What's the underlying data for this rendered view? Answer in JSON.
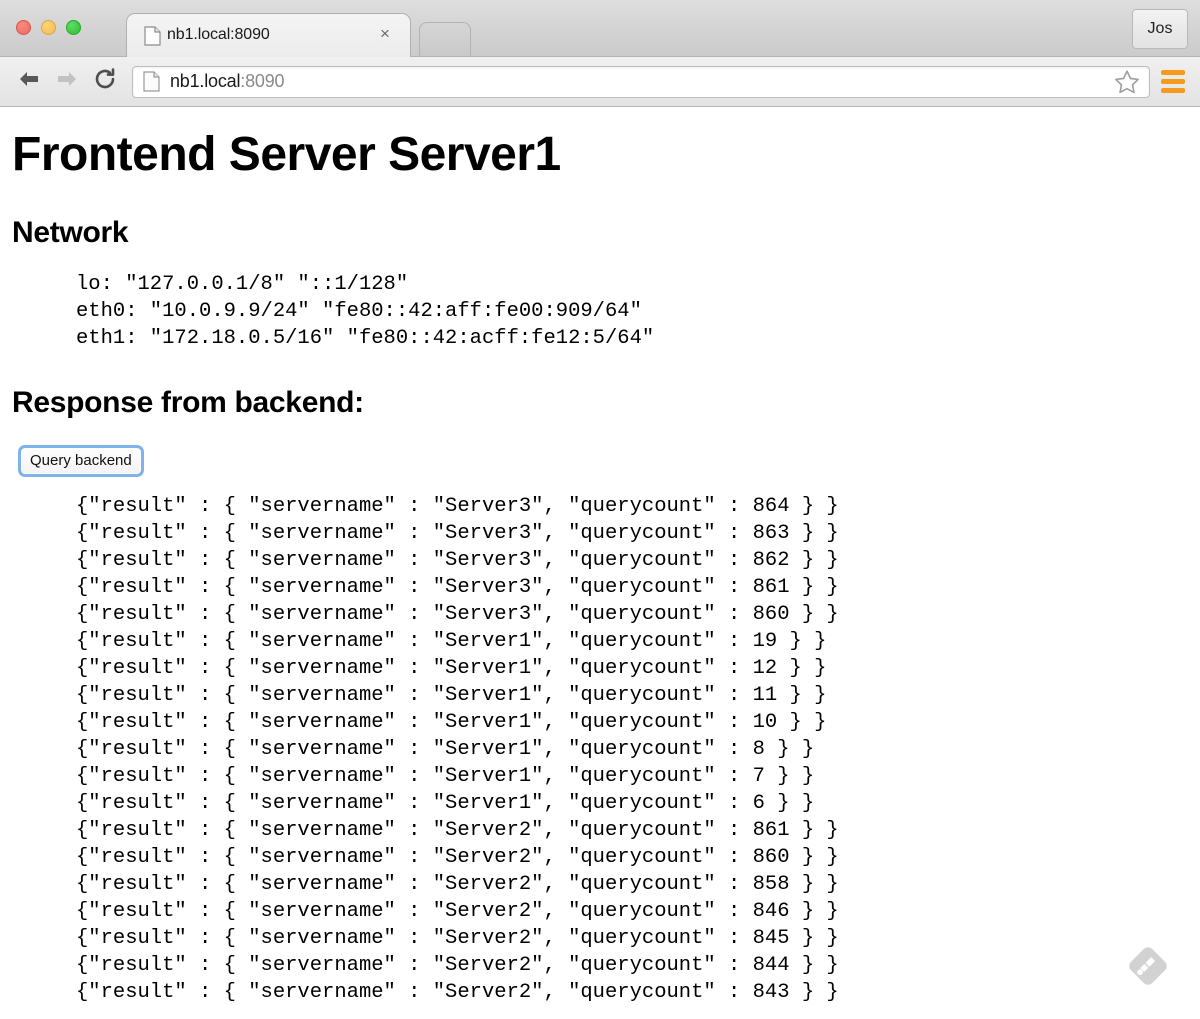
{
  "browser": {
    "window_controls": [
      "close",
      "minimize",
      "zoom"
    ],
    "tab": {
      "title": "nb1.local:8090",
      "close_label": "×",
      "favicon": "document-icon"
    },
    "new_tab_label": "",
    "profile_label": "Jos",
    "toolbar": {
      "back_label": "Back",
      "forward_label": "Forward",
      "reload_label": "Reload",
      "url_host": "nb1.local",
      "url_port": ":8090",
      "bookmark_label": "Bookmark this page",
      "menu_label": "Customize and control",
      "menu_color": "#f59b1c"
    }
  },
  "page": {
    "title": "Frontend Server Server1",
    "network_heading": "Network",
    "network_lines": [
      "lo: \"127.0.0.1/8\" \"::1/128\"",
      "eth0: \"10.0.9.9/24\" \"fe80::42:aff:fe00:909/64\"",
      "eth1: \"172.18.0.5/16\" \"fe80::42:acff:fe12:5/64\""
    ],
    "response_heading": "Response from backend:",
    "query_button_label": "Query backend",
    "results": [
      "{\"result\" : { \"servername\" : \"Server3\", \"querycount\" : 864 } }",
      "{\"result\" : { \"servername\" : \"Server3\", \"querycount\" : 863 } }",
      "{\"result\" : { \"servername\" : \"Server3\", \"querycount\" : 862 } }",
      "{\"result\" : { \"servername\" : \"Server3\", \"querycount\" : 861 } }",
      "{\"result\" : { \"servername\" : \"Server3\", \"querycount\" : 860 } }",
      "{\"result\" : { \"servername\" : \"Server1\", \"querycount\" : 19 } }",
      "{\"result\" : { \"servername\" : \"Server1\", \"querycount\" : 12 } }",
      "{\"result\" : { \"servername\" : \"Server1\", \"querycount\" : 11 } }",
      "{\"result\" : { \"servername\" : \"Server1\", \"querycount\" : 10 } }",
      "{\"result\" : { \"servername\" : \"Server1\", \"querycount\" : 8 } }",
      "{\"result\" : { \"servername\" : \"Server1\", \"querycount\" : 7 } }",
      "{\"result\" : { \"servername\" : \"Server1\", \"querycount\" : 6 } }",
      "{\"result\" : { \"servername\" : \"Server2\", \"querycount\" : 861 } }",
      "{\"result\" : { \"servername\" : \"Server2\", \"querycount\" : 860 } }",
      "{\"result\" : { \"servername\" : \"Server2\", \"querycount\" : 858 } }",
      "{\"result\" : { \"servername\" : \"Server2\", \"querycount\" : 846 } }",
      "{\"result\" : { \"servername\" : \"Server2\", \"querycount\" : 845 } }",
      "{\"result\" : { \"servername\" : \"Server2\", \"querycount\" : 844 } }",
      "{\"result\" : { \"servername\" : \"Server2\", \"querycount\" : 843 } }"
    ],
    "watermark": "feedly-icon"
  }
}
